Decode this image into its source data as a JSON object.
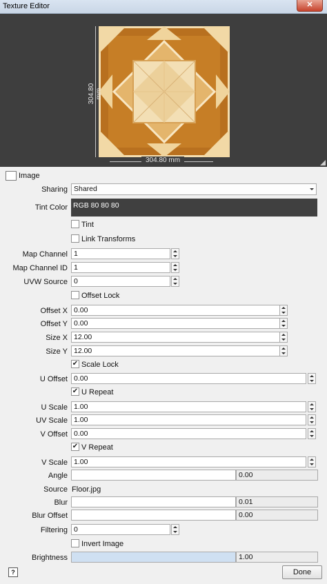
{
  "window": {
    "title": "Texture Editor",
    "close_glyph": "✕"
  },
  "preview": {
    "height_label": "304.80 mm",
    "width_label": "304.80 mm"
  },
  "section": {
    "title": "Image",
    "icon": "image-icon"
  },
  "sharing": {
    "label": "Sharing",
    "value": "Shared"
  },
  "tint_color": {
    "label": "Tint Color",
    "value": "RGB 80 80 80",
    "swatch": "#404040"
  },
  "checkboxes": {
    "tint": {
      "label": "Tint",
      "checked": false
    },
    "link_transforms": {
      "label": "Link Transforms",
      "checked": false
    },
    "offset_lock": {
      "label": "Offset Lock",
      "checked": false
    },
    "scale_lock": {
      "label": "Scale Lock",
      "checked": true
    },
    "u_repeat": {
      "label": "U Repeat",
      "checked": true
    },
    "v_repeat": {
      "label": "V Repeat",
      "checked": true
    },
    "invert_image": {
      "label": "Invert Image",
      "checked": false
    }
  },
  "fields": {
    "map_channel": {
      "label": "Map Channel",
      "value": "1"
    },
    "map_channel_id": {
      "label": "Map Channel ID",
      "value": "1"
    },
    "uvw_source": {
      "label": "UVW Source",
      "value": "0"
    },
    "offset_x": {
      "label": "Offset X",
      "value": "0.00"
    },
    "offset_y": {
      "label": "Offset Y",
      "value": "0.00"
    },
    "size_x": {
      "label": "Size X",
      "value": "12.00"
    },
    "size_y": {
      "label": "Size Y",
      "value": "12.00"
    },
    "u_offset": {
      "label": "U Offset",
      "value": "0.00"
    },
    "u_scale": {
      "label": "U Scale",
      "value": "1.00"
    },
    "uv_scale": {
      "label": "UV Scale",
      "value": "1.00"
    },
    "v_offset": {
      "label": "V Offset",
      "value": "0.00"
    },
    "v_scale": {
      "label": "V Scale",
      "value": "1.00"
    },
    "angle": {
      "label": "Angle",
      "value": "0.00"
    },
    "source": {
      "label": "Source",
      "value": "Floor.jpg"
    },
    "blur": {
      "label": "Blur",
      "value": "0.01"
    },
    "blur_offset": {
      "label": "Blur Offset",
      "value": "0.00"
    },
    "filtering": {
      "label": "Filtering",
      "value": "0"
    },
    "brightness": {
      "label": "Brightness",
      "value": "1.00"
    }
  },
  "footer": {
    "help_label": "?",
    "done_label": "Done"
  }
}
